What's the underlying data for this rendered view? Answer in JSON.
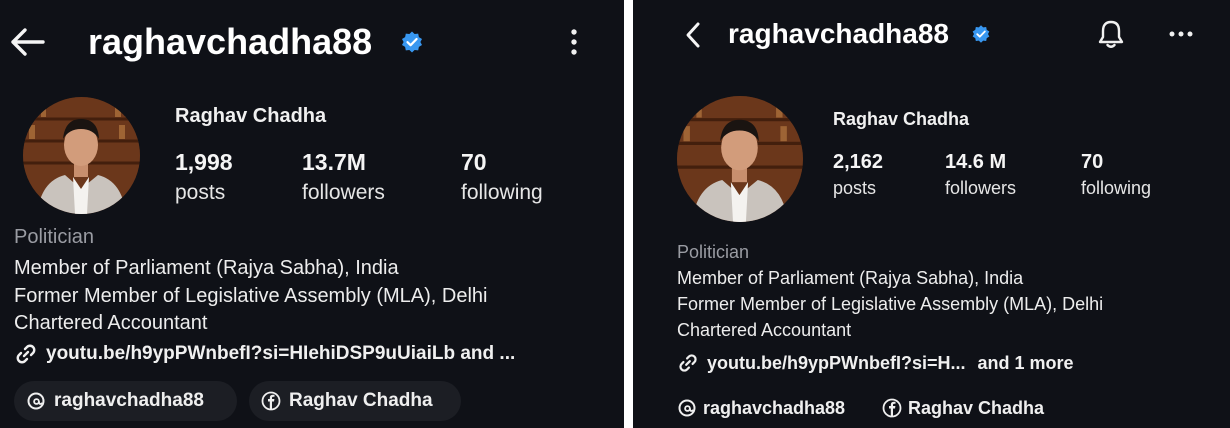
{
  "left": {
    "username": "raghavchadha88",
    "display_name": "Raghav Chadha",
    "stats": [
      {
        "value": "1,998",
        "label": "posts"
      },
      {
        "value": "13.7M",
        "label": "followers"
      },
      {
        "value": "70",
        "label": "following"
      }
    ],
    "category": "Politician",
    "bio": [
      "Member of Parliament (Rajya Sabha), India",
      "Former Member of Legislative Assembly (MLA), Delhi",
      "Chartered Accountant"
    ],
    "link": "youtu.be/h9ypPWnbefI?si=HIehiDSP9uUiaiLb and ...",
    "threads_handle": "raghavchadha88",
    "facebook_name": "Raghav Chadha"
  },
  "right": {
    "username": "raghavchadha88",
    "display_name": "Raghav Chadha",
    "stats": [
      {
        "value": "2,162",
        "label": "posts"
      },
      {
        "value": "14.6 M",
        "label": "followers"
      },
      {
        "value": "70",
        "label": "following"
      }
    ],
    "category": "Politician",
    "bio": [
      "Member of Parliament (Rajya Sabha), India",
      "Former Member of Legislative Assembly (MLA), Delhi",
      "Chartered Accountant"
    ],
    "link": "youtu.be/h9ypPWnbefI?si=H...",
    "link_more": "and 1 more",
    "threads_handle": "raghavchadha88",
    "facebook_name": "Raghav Chadha"
  },
  "colors": {
    "background": "#0f1117",
    "verified": "#3897f0",
    "category_text": "#9a9ca3"
  },
  "icons": [
    "back-arrow-icon",
    "verified-badge-icon",
    "more-vertical-icon",
    "bell-icon",
    "more-horizontal-icon",
    "link-icon",
    "threads-icon",
    "facebook-icon"
  ]
}
